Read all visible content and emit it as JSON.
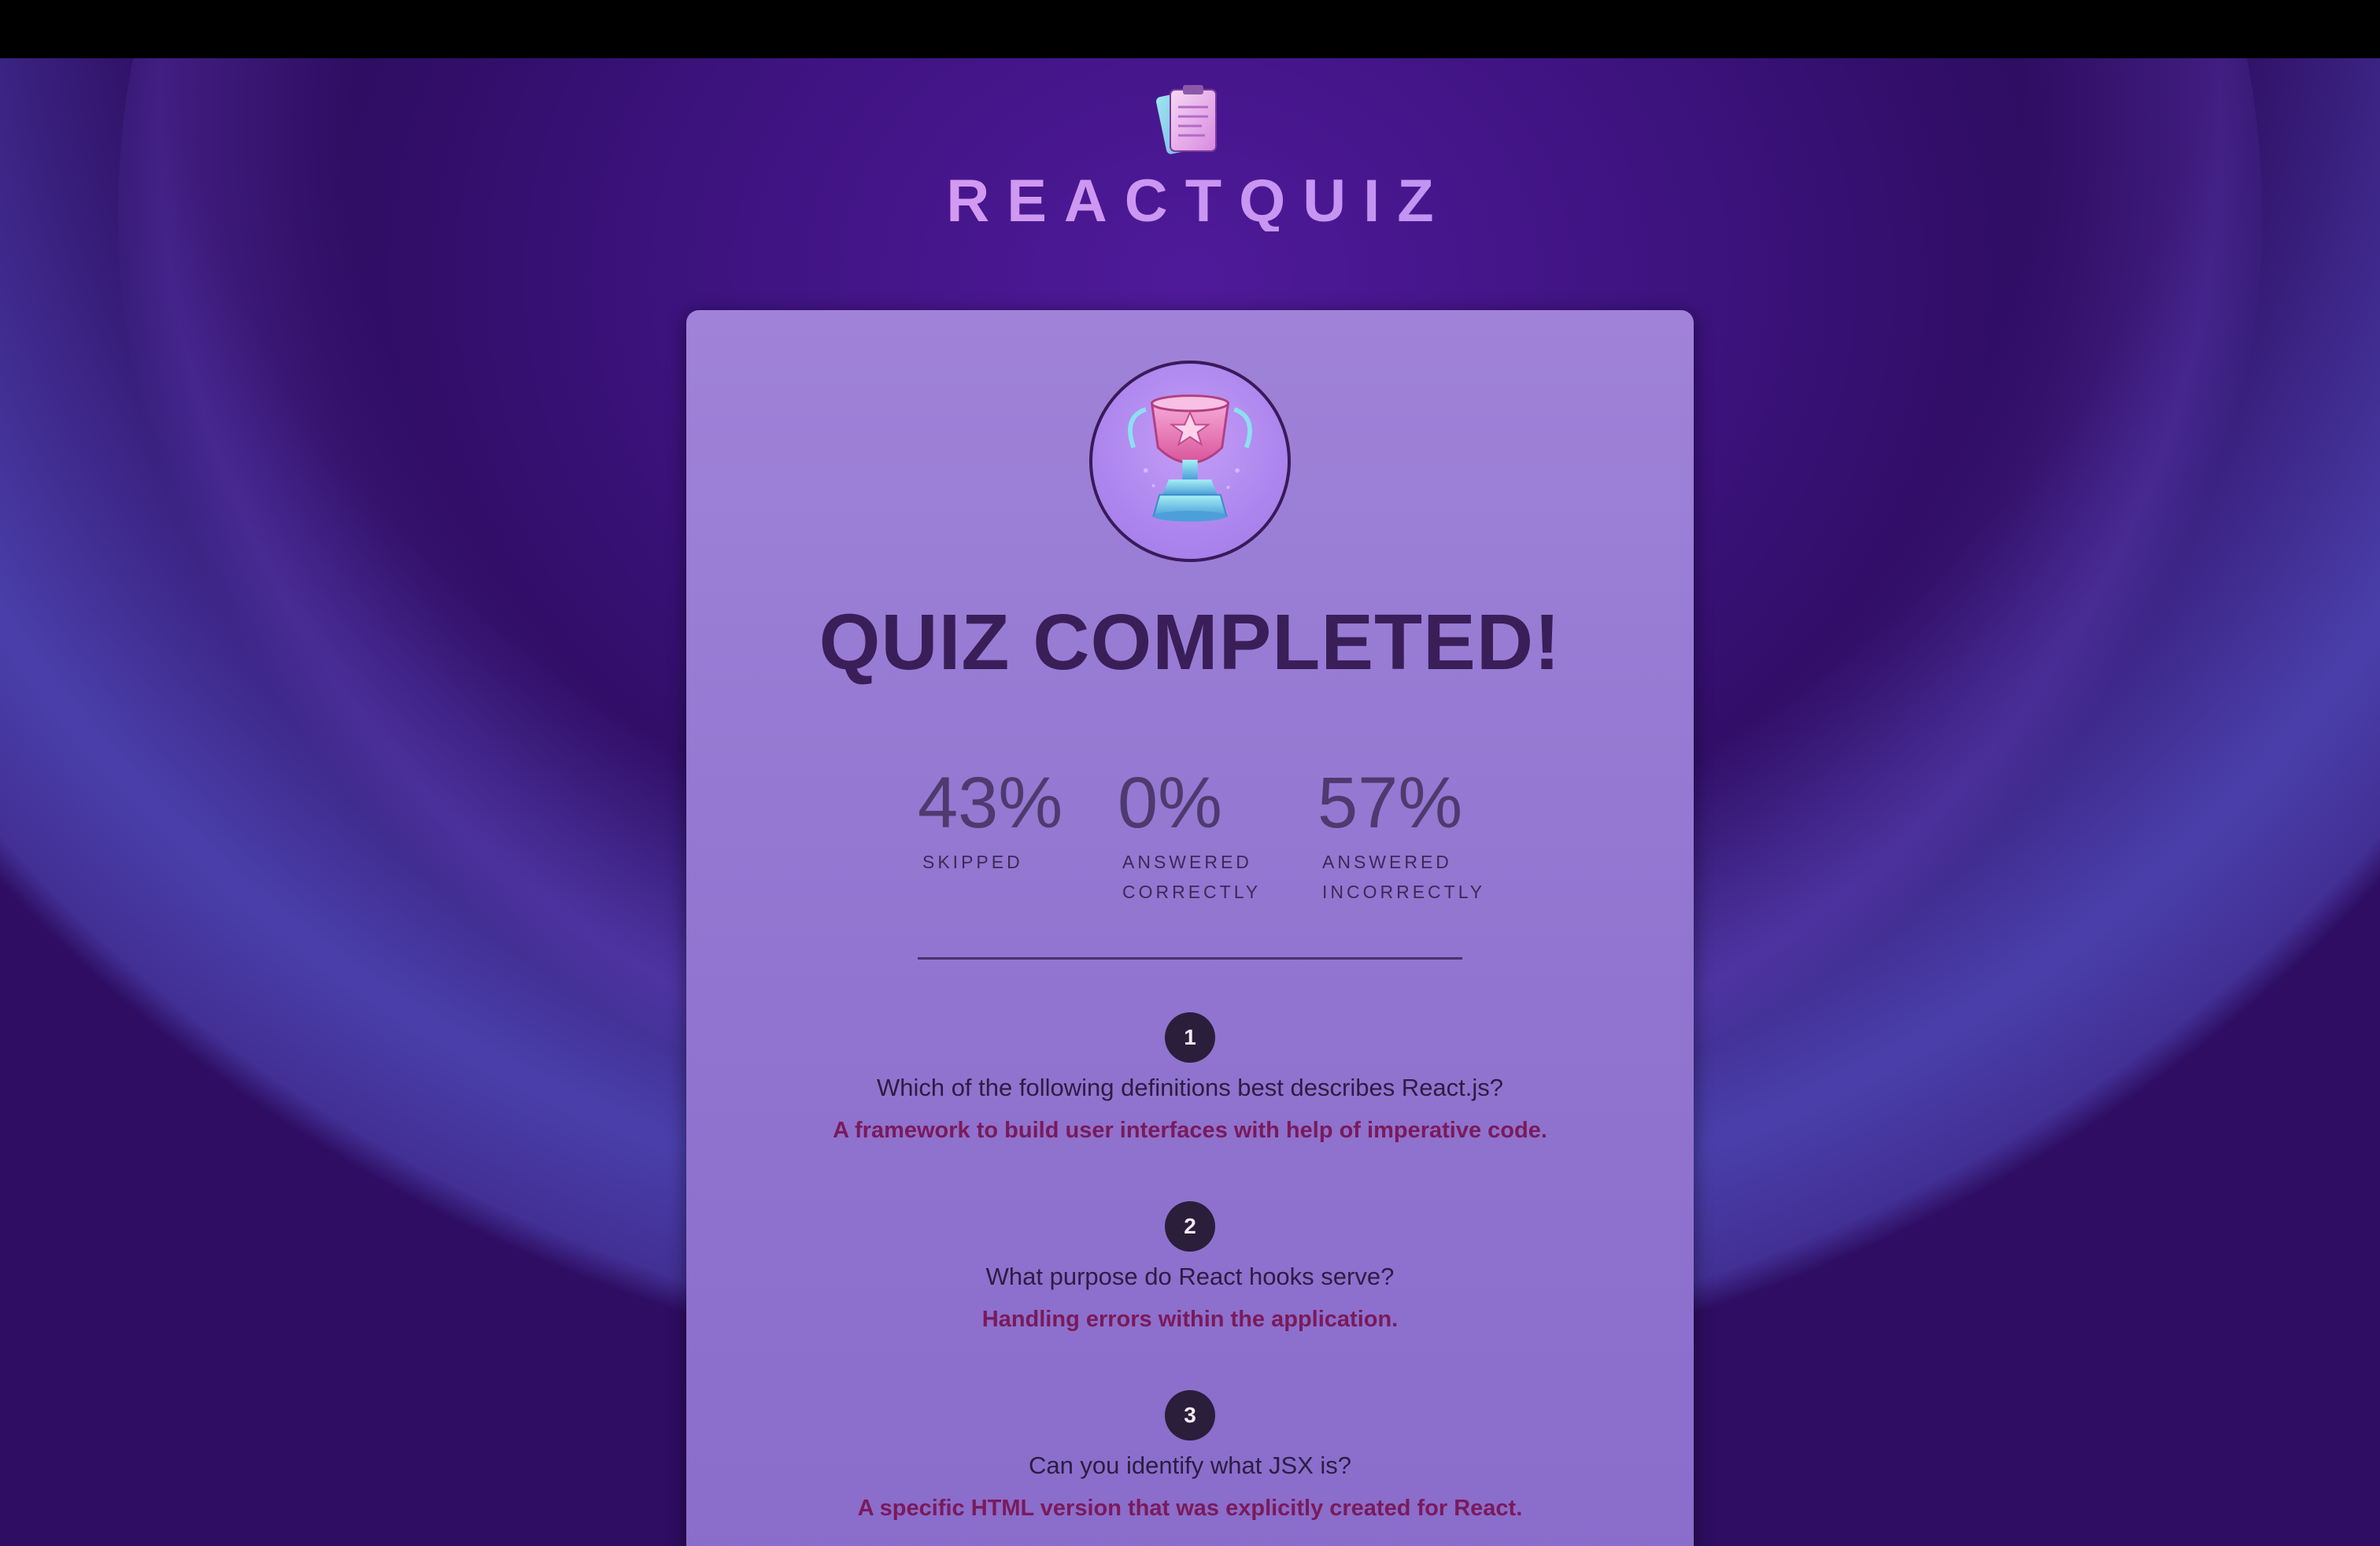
{
  "header": {
    "app_title": "REACTQUIZ",
    "logo_icon": "quiz-logo-icon"
  },
  "summary": {
    "title": "QUIZ COMPLETED!",
    "trophy_icon": "trophy-icon",
    "stats": [
      {
        "value": "43%",
        "label": "Skipped"
      },
      {
        "value": "0%",
        "label": "Answered correctly"
      },
      {
        "value": "57%",
        "label": "Answered incorrectly"
      }
    ]
  },
  "answers": [
    {
      "number": "1",
      "question": "Which of the following definitions best describes React.js?",
      "user_answer": "A framework to build user interfaces with help of imperative code."
    },
    {
      "number": "2",
      "question": "What purpose do React hooks serve?",
      "user_answer": "Handling errors within the application."
    },
    {
      "number": "3",
      "question": "Can you identify what JSX is?",
      "user_answer": "A specific HTML version that was explicitly created for React."
    }
  ],
  "colors": {
    "background": "#3e1380",
    "card": "#9a7ed6",
    "title": "#3a1e58",
    "incorrect_answer": "#7a1a5a",
    "number_badge": "#2a1e3a"
  }
}
